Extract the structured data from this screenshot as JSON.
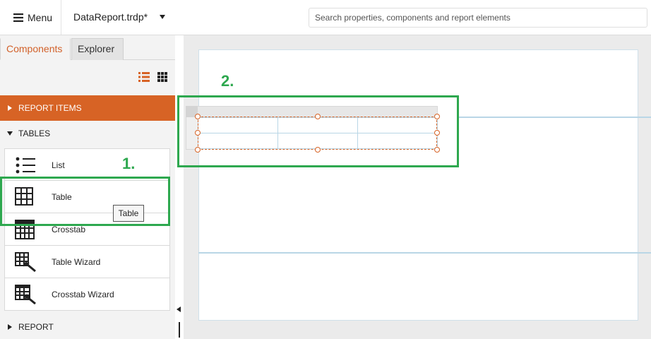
{
  "toolbar": {
    "menu_label": "Menu",
    "file_name": "DataReport.trdp*",
    "search_placeholder": "Search properties, components and report elements"
  },
  "left_panel": {
    "tabs": [
      {
        "label": "Components",
        "active": true
      },
      {
        "label": "Explorer",
        "active": false
      }
    ],
    "sections": {
      "report_items": "REPORT ITEMS",
      "tables": "TABLES",
      "report": "REPORT"
    },
    "items": [
      {
        "label": "List",
        "icon": "list-icon"
      },
      {
        "label": "Table",
        "icon": "table-icon"
      },
      {
        "label": "Crosstab",
        "icon": "crosstab-icon"
      },
      {
        "label": "Table Wizard",
        "icon": "table-wizard-icon"
      },
      {
        "label": "Crosstab Wizard",
        "icon": "crosstab-wizard-icon"
      }
    ],
    "tooltip": "Table"
  },
  "annotations": {
    "step1": "1.",
    "step2": "2."
  },
  "colors": {
    "accent": "#d76325",
    "annotation": "#2ea84f",
    "band_line": "#b9d6e6"
  }
}
